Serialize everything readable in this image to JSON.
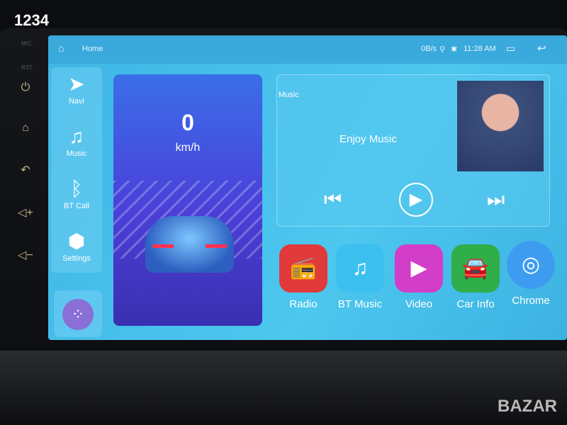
{
  "watermarks": {
    "top_left": "1234",
    "bottom_right": "BAZAR"
  },
  "hardware": {
    "mic_label": "MIC",
    "rst_label": "RST",
    "buttons": [
      "power",
      "home",
      "back",
      "volume-up",
      "volume-down"
    ]
  },
  "status_bar": {
    "home_label": "Home",
    "net_speed": "0B/s",
    "time": "11:28 AM"
  },
  "dock": [
    {
      "label": "Navi",
      "icon": "navigation-arrow-icon"
    },
    {
      "label": "Music",
      "icon": "music-note-icon"
    },
    {
      "label": "BT Call",
      "icon": "bluetooth-icon"
    },
    {
      "label": "Settings",
      "icon": "hexagon-gear-icon"
    }
  ],
  "speed": {
    "value": "0",
    "unit": "km/h"
  },
  "music": {
    "title": "Music",
    "status": "Enjoy Music"
  },
  "apps": [
    {
      "label": "Radio",
      "color": "#e03a3a"
    },
    {
      "label": "BT Music",
      "color": "#3cc0f0"
    },
    {
      "label": "Video",
      "color": "#d23ec8"
    },
    {
      "label": "Car Info",
      "color": "#2fae4a"
    },
    {
      "label": "Chrome",
      "color": "#3d9cf0"
    }
  ]
}
